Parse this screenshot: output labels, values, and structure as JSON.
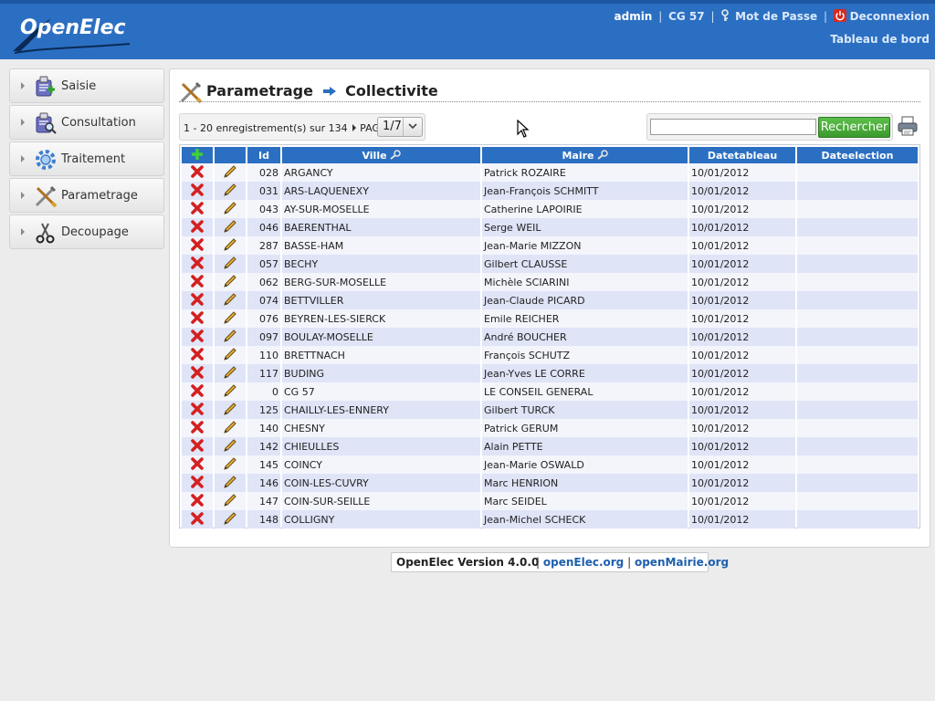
{
  "header": {
    "app_name": "OpenElec",
    "user": "admin",
    "collectivite": "CG 57",
    "password_link": "Mot de Passe",
    "logout_link": "Deconnexion",
    "dashboard_link": "Tableau de bord",
    "sep": "|"
  },
  "sidebar": {
    "items": [
      {
        "label": "Saisie",
        "icon": "saisie-icon"
      },
      {
        "label": "Consultation",
        "icon": "consultation-icon"
      },
      {
        "label": "Traitement",
        "icon": "traitement-icon"
      },
      {
        "label": "Parametrage",
        "icon": "parametrage-icon"
      },
      {
        "label": "Decoupage",
        "icon": "decoupage-icon"
      }
    ]
  },
  "main": {
    "breadcrumb_parent": "Parametrage",
    "breadcrumb_current": "Collectivite",
    "pager_info": "1 - 20 enregistrement(s) sur 134",
    "page_label": "PAGE -",
    "page_value": "1/7",
    "search_value": "",
    "search_button": "Rechercher"
  },
  "table": {
    "columns": {
      "id": "Id",
      "ville": "Ville",
      "maire": "Maire",
      "datetableau": "Datetableau",
      "dateelection": "Dateelection"
    },
    "rows": [
      {
        "id": "028",
        "ville": "ARGANCY",
        "maire": "Patrick ROZAIRE",
        "datetableau": "10/01/2012",
        "dateelection": ""
      },
      {
        "id": "031",
        "ville": "ARS-LAQUENEXY",
        "maire": "Jean-François SCHMITT",
        "datetableau": "10/01/2012",
        "dateelection": ""
      },
      {
        "id": "043",
        "ville": "AY-SUR-MOSELLE",
        "maire": "Catherine LAPOIRIE",
        "datetableau": "10/01/2012",
        "dateelection": ""
      },
      {
        "id": "046",
        "ville": "BAERENTHAL",
        "maire": "Serge WEIL",
        "datetableau": "10/01/2012",
        "dateelection": ""
      },
      {
        "id": "287",
        "ville": "BASSE-HAM",
        "maire": "Jean-Marie MIZZON",
        "datetableau": "10/01/2012",
        "dateelection": ""
      },
      {
        "id": "057",
        "ville": "BECHY",
        "maire": "Gilbert CLAUSSE",
        "datetableau": "10/01/2012",
        "dateelection": ""
      },
      {
        "id": "062",
        "ville": "BERG-SUR-MOSELLE",
        "maire": "Michèle SCIARINI",
        "datetableau": "10/01/2012",
        "dateelection": ""
      },
      {
        "id": "074",
        "ville": "BETTVILLER",
        "maire": "Jean-Claude PICARD",
        "datetableau": "10/01/2012",
        "dateelection": ""
      },
      {
        "id": "076",
        "ville": "BEYREN-LES-SIERCK",
        "maire": "Emile REICHER",
        "datetableau": "10/01/2012",
        "dateelection": ""
      },
      {
        "id": "097",
        "ville": "BOULAY-MOSELLE",
        "maire": "André BOUCHER",
        "datetableau": "10/01/2012",
        "dateelection": ""
      },
      {
        "id": "110",
        "ville": "BRETTNACH",
        "maire": "François SCHUTZ",
        "datetableau": "10/01/2012",
        "dateelection": ""
      },
      {
        "id": "117",
        "ville": "BUDING",
        "maire": "Jean-Yves LE CORRE",
        "datetableau": "10/01/2012",
        "dateelection": ""
      },
      {
        "id": "0",
        "ville": "CG 57",
        "maire": "LE CONSEIL GENERAL",
        "datetableau": "10/01/2012",
        "dateelection": ""
      },
      {
        "id": "125",
        "ville": "CHAILLY-LES-ENNERY",
        "maire": "Gilbert TURCK",
        "datetableau": "10/01/2012",
        "dateelection": ""
      },
      {
        "id": "140",
        "ville": "CHESNY",
        "maire": "Patrick GERUM",
        "datetableau": "10/01/2012",
        "dateelection": ""
      },
      {
        "id": "142",
        "ville": "CHIEULLES",
        "maire": "Alain PETTE",
        "datetableau": "10/01/2012",
        "dateelection": ""
      },
      {
        "id": "145",
        "ville": "COINCY",
        "maire": "Jean-Marie OSWALD",
        "datetableau": "10/01/2012",
        "dateelection": ""
      },
      {
        "id": "146",
        "ville": "COIN-LES-CUVRY",
        "maire": "Marc HENRION",
        "datetableau": "10/01/2012",
        "dateelection": ""
      },
      {
        "id": "147",
        "ville": "COIN-SUR-SEILLE",
        "maire": "Marc SEIDEL",
        "datetableau": "10/01/2012",
        "dateelection": ""
      },
      {
        "id": "148",
        "ville": "COLLIGNY",
        "maire": "Jean-Michel SCHECK",
        "datetableau": "10/01/2012",
        "dateelection": ""
      }
    ]
  },
  "footer": {
    "version": "OpenElec Version 4.0.0",
    "link1": "openElec.org",
    "link2": "openMairie.org",
    "sep": "|"
  },
  "colors": {
    "header_blue": "#2b6fc2",
    "table_header": "#2b6fc2",
    "row_alt": "#dfe4f7",
    "search_button": "#4aae3c",
    "delete_red": "#d42020"
  }
}
